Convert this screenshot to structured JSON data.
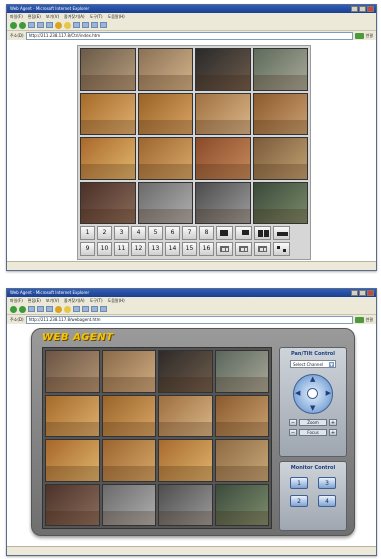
{
  "window_top": {
    "title": "Web Agent - Microsoft Internet Explorer",
    "menu": [
      "파일(F)",
      "편집(E)",
      "보기(V)",
      "즐겨찾기(A)",
      "도구(T)",
      "도움말(H)"
    ],
    "address_label": "주소(D)",
    "address_url": "http://211.238.117.8/Ctrl/index.htm",
    "links_label": "연결",
    "channels_row1": [
      "1",
      "2",
      "3",
      "4",
      "5",
      "6",
      "7",
      "8"
    ],
    "channels_row2": [
      "9",
      "10",
      "11",
      "12",
      "13",
      "14",
      "15",
      "16"
    ]
  },
  "window_bottom": {
    "title": "Web Agent - Microsoft Internet Explorer",
    "menu": [
      "파일(F)",
      "편집(E)",
      "보기(V)",
      "즐겨찾기(A)",
      "도구(T)",
      "도움말(H)"
    ],
    "address_label": "주소(D)",
    "address_url": "http://211.238.117.8/webagent.htm",
    "links_label": "연결",
    "app_title": "WEB AGENT",
    "ptz_title": "Pan/Tilt Control",
    "select_channel": "Select Channel",
    "zoom_label": "Zoom",
    "focus_label": "Focus",
    "monitor_title": "Monitor Control",
    "monitor_buttons": [
      "1",
      "2",
      "3",
      "4"
    ]
  },
  "colors": {
    "titlebar": "#1c3f8e",
    "agent_title": "#f5c400",
    "panel_accent": "#1a3d7a"
  }
}
